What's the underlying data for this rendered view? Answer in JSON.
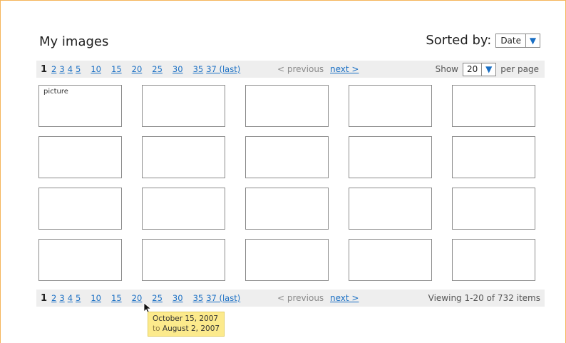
{
  "header": {
    "title": "My images",
    "sort_label": "Sorted by:",
    "sort_value": "Date"
  },
  "pagination": {
    "current": "1",
    "pages": [
      "2",
      "3",
      "4",
      "5",
      "10",
      "15",
      "20",
      "25",
      "30",
      "35",
      "37 (last)"
    ],
    "previous_label": "< previous",
    "next_label": "next >"
  },
  "top_bar": {
    "show_label": "Show",
    "per_page_value": "20",
    "per_page_label": "per page"
  },
  "bottom_bar": {
    "viewing_text": "Viewing 1-20 of 732 items"
  },
  "grid": {
    "first_label": "picture"
  },
  "tooltip": {
    "line1": "October 15, 2007",
    "line2_prefix": "to",
    "line2_date": "August 2, 2007"
  },
  "colors": {
    "link": "#1a6fc4",
    "bar_background": "#eeeeee",
    "frame_border": "#f5b55b",
    "tooltip_background": "#fcea8c"
  }
}
